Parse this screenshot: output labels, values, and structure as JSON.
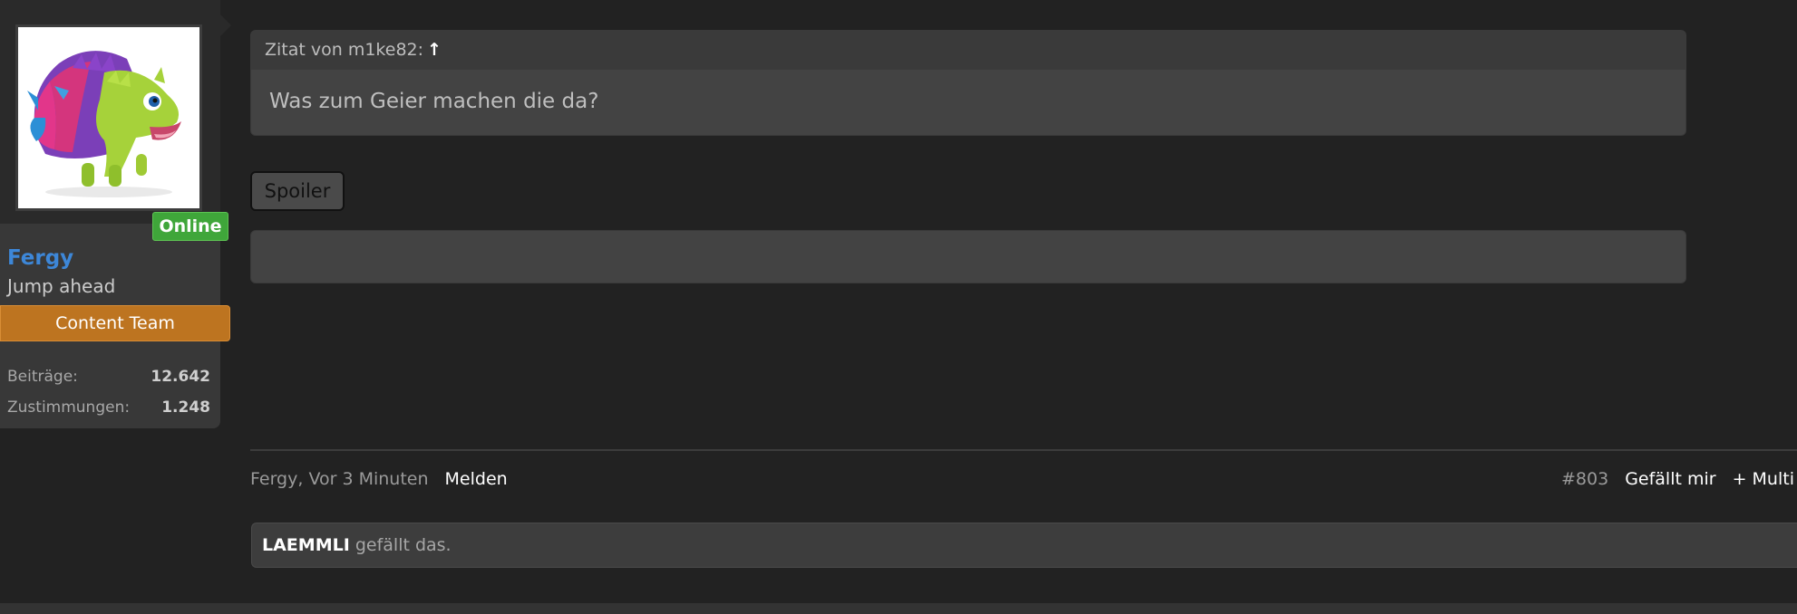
{
  "user": {
    "name": "Fergy",
    "user_title": "Jump ahead",
    "status": "Online",
    "role": "Content Team",
    "stats": [
      {
        "label": "Beiträge:",
        "value": "12.642"
      },
      {
        "label": "Zustimmungen:",
        "value": "1.248"
      }
    ],
    "avatar": "hedgehog-creature-avatar",
    "colors": {
      "name": "#3d87d8",
      "online": "#3fa63a",
      "role": "#bd7420"
    }
  },
  "post": {
    "quote": {
      "header": "Zitat von m1ke82:",
      "arrow_icon": "↑",
      "text": "Was zum Geier machen die da?"
    },
    "spoiler_label": "Spoiler",
    "meta": {
      "author_time": "Fergy, Vor 3 Minuten",
      "report": "Melden"
    },
    "actions": {
      "number": "#803",
      "like": "Gefällt mir",
      "multi": "+ Multi"
    },
    "likes": {
      "user": "LAEMMLI",
      "text": "gefällt das."
    }
  }
}
